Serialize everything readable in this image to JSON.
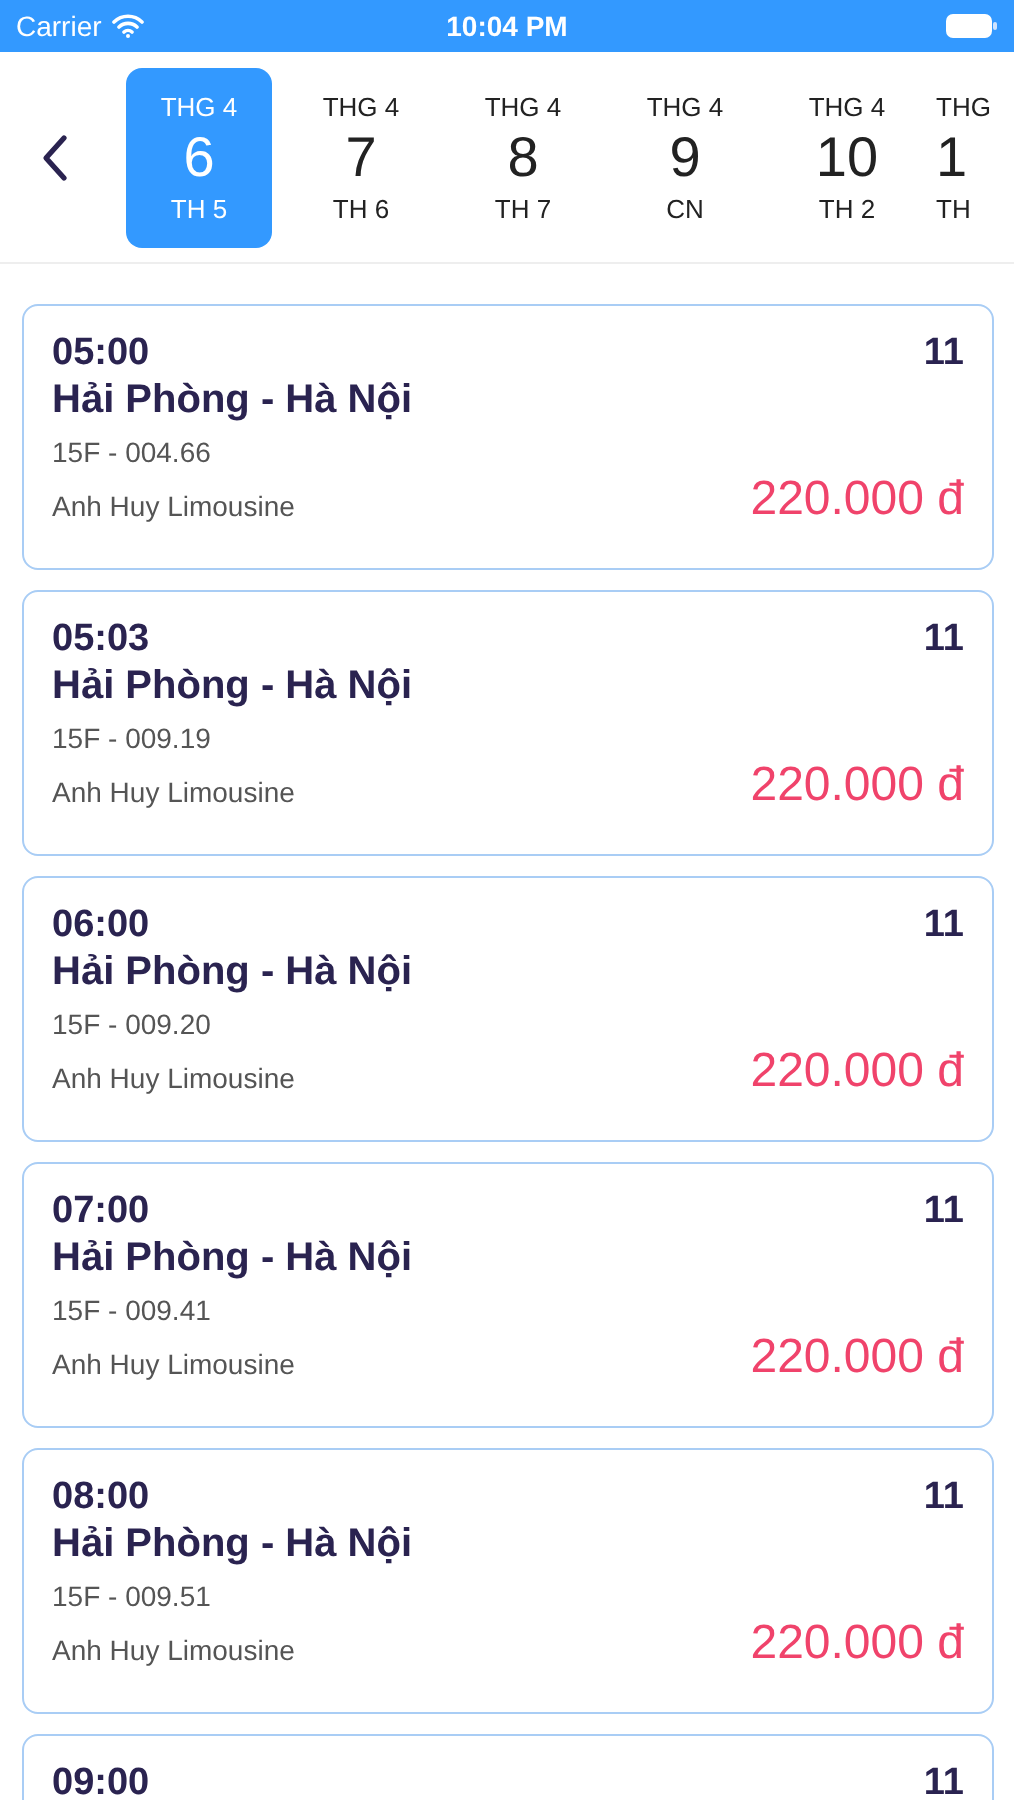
{
  "status_bar": {
    "carrier": "Carrier",
    "time": "10:04 PM"
  },
  "dates": [
    {
      "month": "THG 4",
      "day": "6",
      "weekday": "TH 5",
      "selected": true
    },
    {
      "month": "THG 4",
      "day": "7",
      "weekday": "TH 6",
      "selected": false
    },
    {
      "month": "THG 4",
      "day": "8",
      "weekday": "TH 7",
      "selected": false
    },
    {
      "month": "THG 4",
      "day": "9",
      "weekday": "CN",
      "selected": false
    },
    {
      "month": "THG 4",
      "day": "10",
      "weekday": "TH 2",
      "selected": false
    },
    {
      "month": "THG",
      "day": "1",
      "weekday": "TH",
      "selected": false
    }
  ],
  "trips": [
    {
      "time": "05:00",
      "seats": "11",
      "route": "Hải Phòng - Hà Nội",
      "plate": "15F - 004.66",
      "operator": "Anh Huy Limousine",
      "price": "220.000 đ"
    },
    {
      "time": "05:03",
      "seats": "11",
      "route": "Hải Phòng - Hà Nội",
      "plate": "15F - 009.19",
      "operator": "Anh Huy Limousine",
      "price": "220.000 đ"
    },
    {
      "time": "06:00",
      "seats": "11",
      "route": "Hải Phòng - Hà Nội",
      "plate": "15F - 009.20",
      "operator": "Anh Huy Limousine",
      "price": "220.000 đ"
    },
    {
      "time": "07:00",
      "seats": "11",
      "route": "Hải Phòng - Hà Nội",
      "plate": "15F - 009.41",
      "operator": "Anh Huy Limousine",
      "price": "220.000 đ"
    },
    {
      "time": "08:00",
      "seats": "11",
      "route": "Hải Phòng - Hà Nội",
      "plate": "15F - 009.51",
      "operator": "Anh Huy Limousine",
      "price": "220.000 đ"
    },
    {
      "time": "09:00",
      "seats": "11"
    }
  ]
}
